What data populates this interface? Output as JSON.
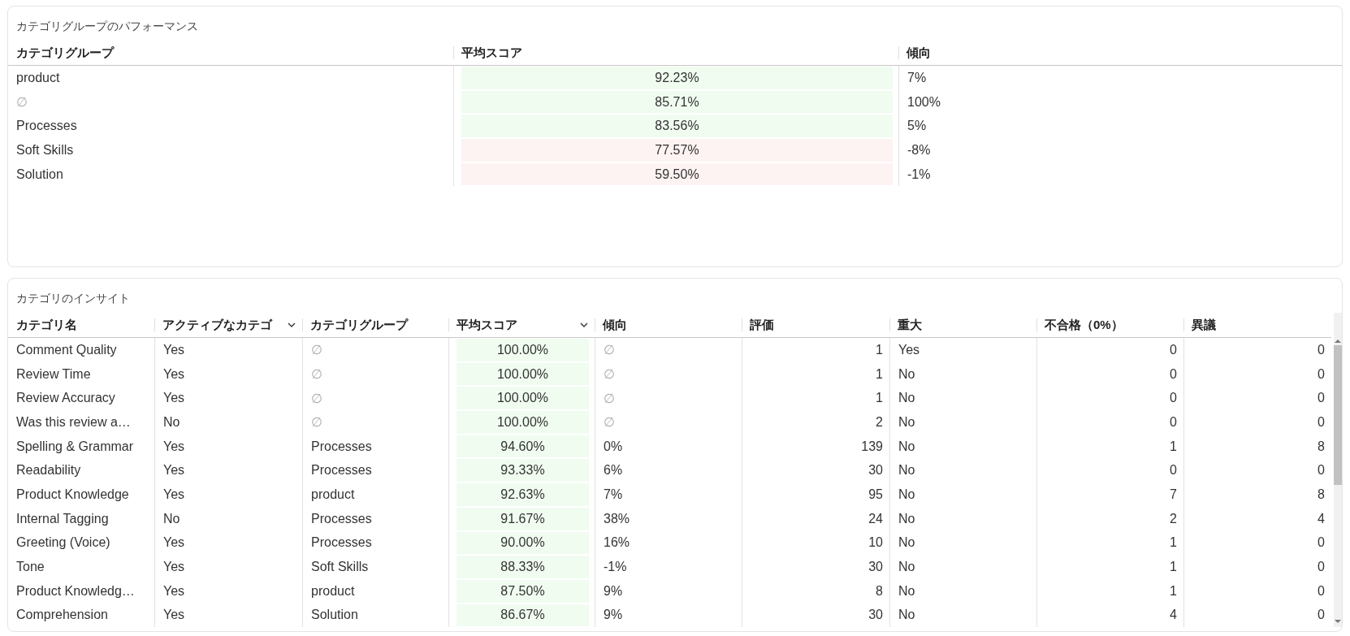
{
  "group_panel": {
    "title": "カテゴリグループのパフォーマンス",
    "columns": [
      {
        "label": "カテゴリグループ",
        "kind": "text",
        "sortable": false
      },
      {
        "label": "平均スコア",
        "kind": "score",
        "sortable": false
      },
      {
        "label": "傾向",
        "kind": "text",
        "sortable": false
      }
    ],
    "rows": [
      {
        "cells": [
          "product",
          {
            "text": "92.23%",
            "color": "#f0fcf0"
          },
          "7%"
        ]
      },
      {
        "cells": [
          {
            "text": "∅",
            "muted": true
          },
          {
            "text": "85.71%",
            "color": "#f0fcf0"
          },
          "100%"
        ]
      },
      {
        "cells": [
          "Processes",
          {
            "text": "83.56%",
            "color": "#f0fcf0"
          },
          "5%"
        ]
      },
      {
        "cells": [
          "Soft Skills",
          {
            "text": "77.57%",
            "color": "#fdf3f2"
          },
          "-8%"
        ]
      },
      {
        "cells": [
          "Solution",
          {
            "text": "59.50%",
            "color": "#fdf3f2"
          },
          "-1%"
        ]
      }
    ]
  },
  "insight_panel": {
    "title": "カテゴリのインサイト",
    "columns": [
      {
        "label": "カテゴリ名",
        "kind": "text",
        "sortable": false
      },
      {
        "label": "アクティブなカテゴ",
        "kind": "text",
        "sortable": true
      },
      {
        "label": "カテゴリグループ",
        "kind": "text",
        "sortable": false
      },
      {
        "label": "平均スコア",
        "kind": "score",
        "sortable": true
      },
      {
        "label": "傾向",
        "kind": "text",
        "sortable": false
      },
      {
        "label": "評価",
        "kind": "number",
        "sortable": false
      },
      {
        "label": "重大",
        "kind": "text",
        "sortable": false
      },
      {
        "label": "不合格（0%）",
        "kind": "number",
        "sortable": false
      },
      {
        "label": "異議",
        "kind": "number",
        "sortable": false
      }
    ],
    "rows": [
      {
        "cells": [
          "Comment Quality",
          "Yes",
          {
            "text": "∅",
            "muted": true
          },
          {
            "text": "100.00%",
            "color": "#f0fcf0"
          },
          {
            "text": "∅",
            "muted": true
          },
          "1",
          "Yes",
          "0",
          "0"
        ]
      },
      {
        "cells": [
          "Review Time",
          "Yes",
          {
            "text": "∅",
            "muted": true
          },
          {
            "text": "100.00%",
            "color": "#f0fcf0"
          },
          {
            "text": "∅",
            "muted": true
          },
          "1",
          "No",
          "0",
          "0"
        ]
      },
      {
        "cells": [
          "Review Accuracy",
          "Yes",
          {
            "text": "∅",
            "muted": true
          },
          {
            "text": "100.00%",
            "color": "#f0fcf0"
          },
          {
            "text": "∅",
            "muted": true
          },
          "1",
          "No",
          "0",
          "0"
        ]
      },
      {
        "cells": [
          "Was this review a…",
          "No",
          {
            "text": "∅",
            "muted": true
          },
          {
            "text": "100.00%",
            "color": "#f0fcf0"
          },
          {
            "text": "∅",
            "muted": true
          },
          "2",
          "No",
          "0",
          "0"
        ]
      },
      {
        "cells": [
          "Spelling & Grammar",
          "Yes",
          "Processes",
          {
            "text": "94.60%",
            "color": "#f0fcf0"
          },
          "0%",
          "139",
          "No",
          "1",
          "8"
        ]
      },
      {
        "cells": [
          "Readability",
          "Yes",
          "Processes",
          {
            "text": "93.33%",
            "color": "#f0fcf0"
          },
          "6%",
          "30",
          "No",
          "0",
          "0"
        ]
      },
      {
        "cells": [
          "Product Knowledge",
          "Yes",
          "product",
          {
            "text": "92.63%",
            "color": "#f0fcf0"
          },
          "7%",
          "95",
          "No",
          "7",
          "8"
        ]
      },
      {
        "cells": [
          "Internal Tagging",
          "No",
          "Processes",
          {
            "text": "91.67%",
            "color": "#f0fcf0"
          },
          "38%",
          "24",
          "No",
          "2",
          "4"
        ]
      },
      {
        "cells": [
          "Greeting (Voice)",
          "Yes",
          "Processes",
          {
            "text": "90.00%",
            "color": "#f0fcf0"
          },
          "16%",
          "10",
          "No",
          "1",
          "0"
        ]
      },
      {
        "cells": [
          "Tone",
          "Yes",
          "Soft Skills",
          {
            "text": "88.33%",
            "color": "#f0fcf0"
          },
          "-1%",
          "30",
          "No",
          "1",
          "0"
        ]
      },
      {
        "cells": [
          "Product Knowledg…",
          "Yes",
          "product",
          {
            "text": "87.50%",
            "color": "#f0fcf0"
          },
          "9%",
          "8",
          "No",
          "1",
          "0"
        ]
      },
      {
        "cells": [
          "Comprehension",
          "Yes",
          "Solution",
          {
            "text": "86.67%",
            "color": "#f0fcf0"
          },
          "9%",
          "30",
          "No",
          "4",
          "0"
        ]
      }
    ]
  }
}
